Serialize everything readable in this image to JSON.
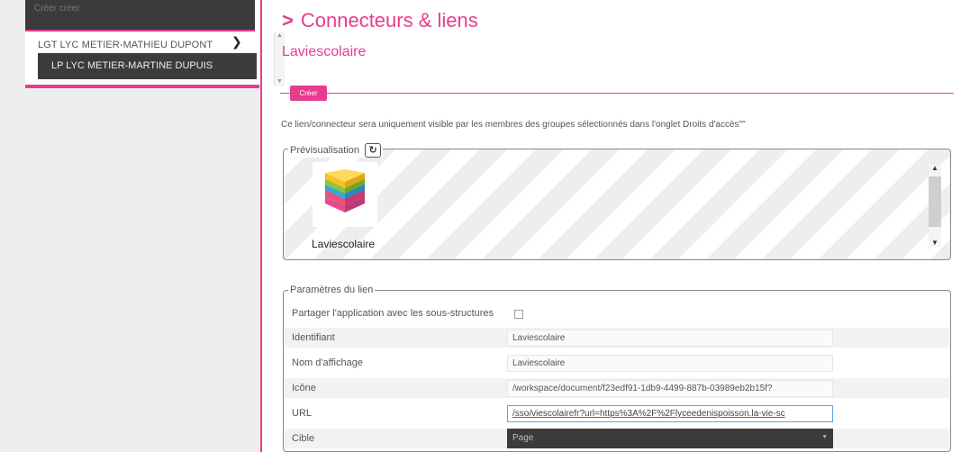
{
  "sidebar": {
    "top_label": "Créer créer",
    "item_label": "LGT LYC METIER-MATHIEU DUPONT",
    "selected_label": "LP LYC METIER-MARTINE DUPUIS"
  },
  "main": {
    "title": "Connecteurs & liens",
    "subtitle": "Laviescolaire",
    "create_label": "Créer",
    "info": "Ce lien/connecteur sera uniquement visible par les membres des groupes sélectionnés dans l'onglet Droits d'accès\"\""
  },
  "preview": {
    "legend": "Prévisualisation",
    "app_name": "Laviescolaire"
  },
  "params": {
    "legend": "Paramètres du lien",
    "share_label": "Partager l'application avec les sous-structures",
    "identifiant_label": "Identifiant",
    "identifiant_value": "Laviescolaire",
    "nom_label": "Nom d'affichage",
    "nom_value": "Laviescolaire",
    "icone_label": "Icône",
    "icone_value": "/workspace/document/f23edf91-1db9-4499-887b-03989eb2b15f?",
    "url_label": "URL",
    "url_value": "/sso/viescolairefr?url=https%3A%2F%2Flyceedenispoisson.la-vie-sc",
    "cible_label": "Cible",
    "cible_value": "Page"
  },
  "colors": {
    "accent": "#e63c8e",
    "dark": "#3b3b3b"
  }
}
